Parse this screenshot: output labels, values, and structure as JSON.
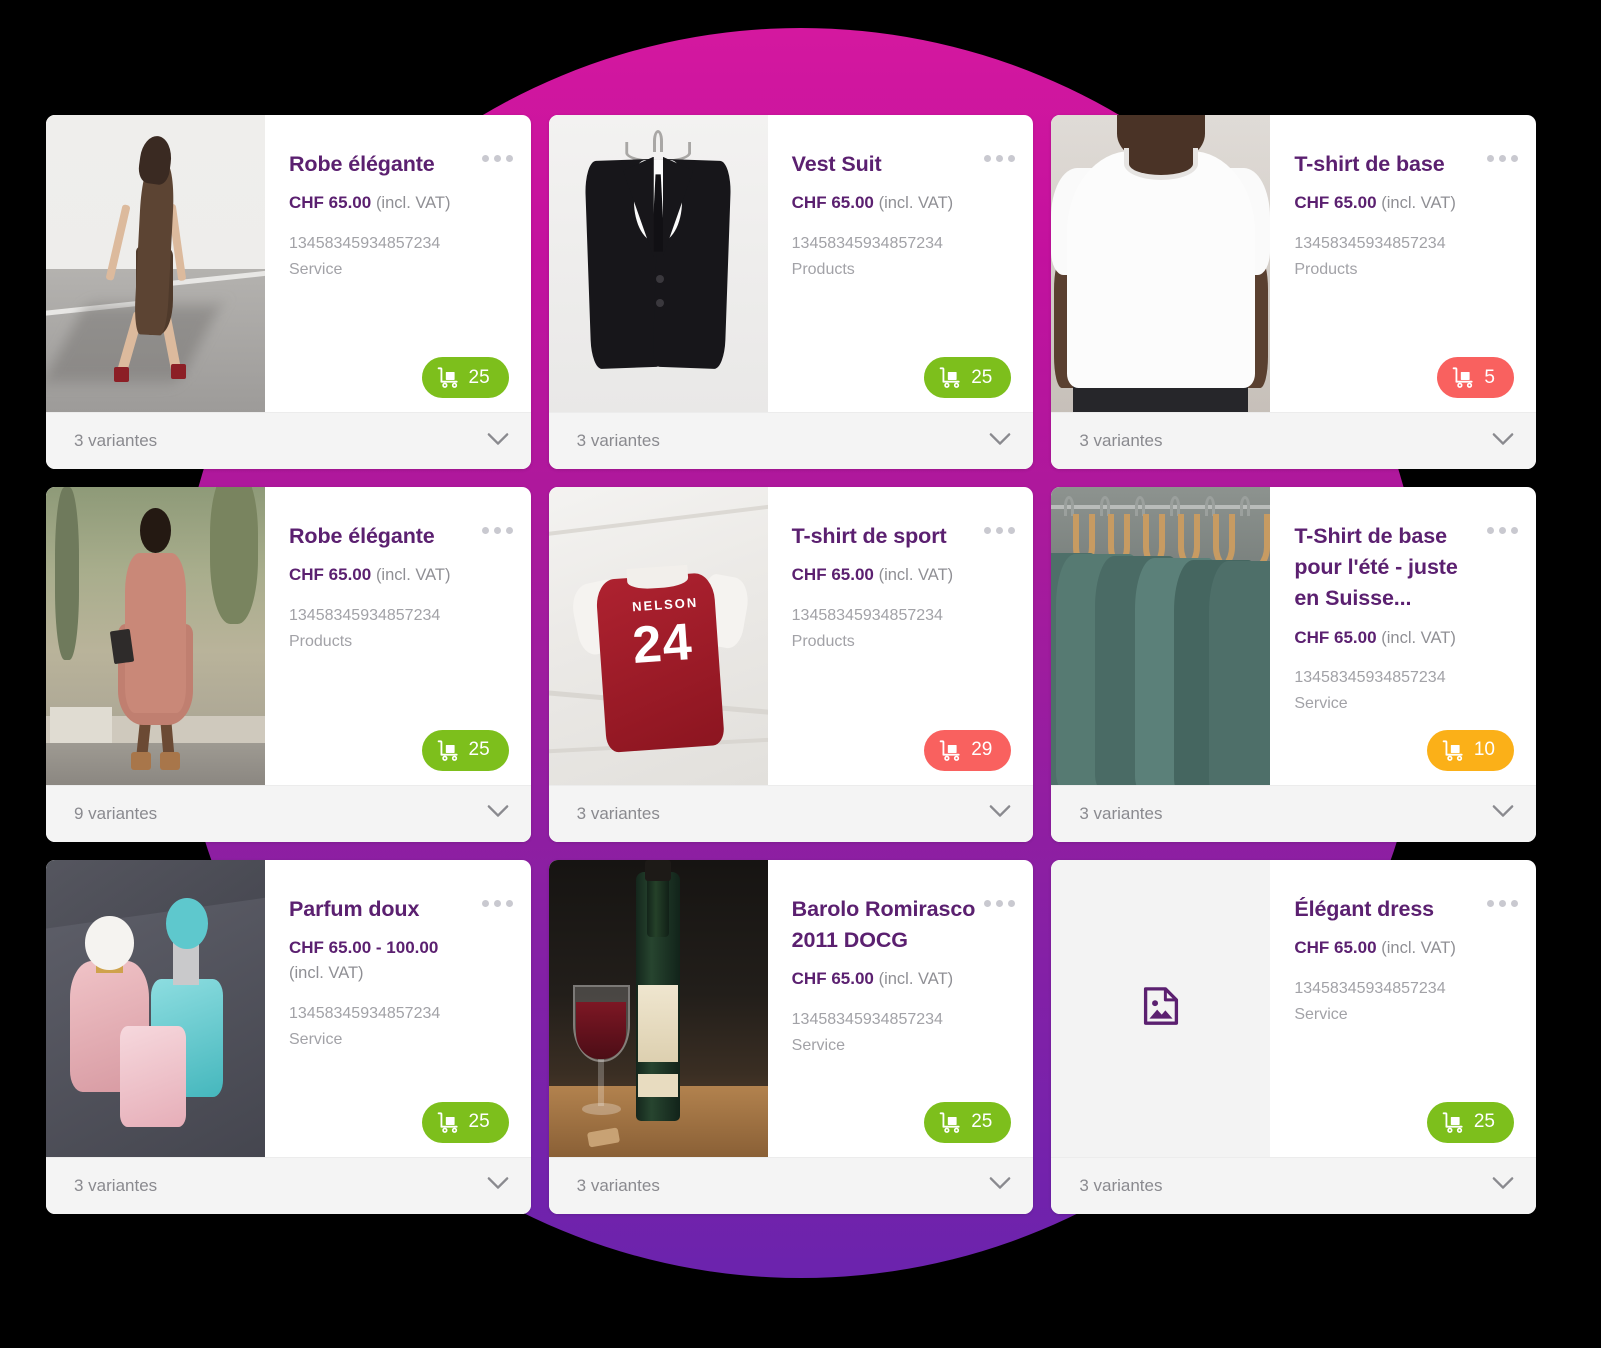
{
  "theme": {
    "accent_purple": "#5b2070",
    "gradient_top": "#d4189f",
    "gradient_bottom": "#6b23ad",
    "badge_green": "#7dbf1c",
    "badge_red": "#f9615f",
    "badge_orange": "#fbb018",
    "card_background": "#ffffff",
    "footer_background": "#f4f4f4",
    "muted_text": "#a2a2a7"
  },
  "labels": {
    "vat_suffix": "(incl. VAT)",
    "overflow_menu": "more-options",
    "expand": "expand-variants"
  },
  "products": [
    {
      "id": "robe-elegante-1",
      "title": "Robe élégante",
      "price": "CHF 65.00",
      "vat": "(incl. VAT)",
      "sku": "13458345934857234",
      "category": "Service",
      "stock": "25",
      "stock_color": "#7dbf1c",
      "variants": "3 variantes",
      "image": "img-dress1",
      "has_image": true
    },
    {
      "id": "vest-suit",
      "title": "Vest Suit",
      "price": "CHF 65.00",
      "vat": "(incl. VAT)",
      "sku": "13458345934857234",
      "category": "Products",
      "stock": "25",
      "stock_color": "#7dbf1c",
      "variants": "3 variantes",
      "image": "img-suit",
      "has_image": true
    },
    {
      "id": "t-shirt-de-base",
      "title": "T-shirt de base",
      "price": "CHF 65.00",
      "vat": "(incl. VAT)",
      "sku": "13458345934857234",
      "category": "Products",
      "stock": "5",
      "stock_color": "#f9615f",
      "variants": "3 variantes",
      "image": "img-tshirt-white",
      "has_image": true
    },
    {
      "id": "robe-elegante-2",
      "title": "Robe élégante",
      "price": "CHF 65.00",
      "vat": "(incl. VAT)",
      "sku": "13458345934857234",
      "category": "Products",
      "stock": "25",
      "stock_color": "#7dbf1c",
      "variants": "9 variantes",
      "image": "img-dress2",
      "has_image": true
    },
    {
      "id": "t-shirt-de-sport",
      "title": "T-shirt de sport",
      "price": "CHF 65.00",
      "vat": "(incl. VAT)",
      "sku": "13458345934857234",
      "category": "Products",
      "stock": "29",
      "stock_color": "#f9615f",
      "variants": "3 variantes",
      "image": "img-jersey",
      "has_image": true
    },
    {
      "id": "t-shirt-de-base-ete",
      "title": "T-Shirt de base pour l'été - juste en Suisse...",
      "price": "CHF 65.00",
      "vat": "(incl. VAT)",
      "sku": "13458345934857234",
      "category": "Service",
      "stock": "10",
      "stock_color": "#fbb018",
      "variants": "3 variantes",
      "image": "img-hangers",
      "has_image": true
    },
    {
      "id": "parfum-doux",
      "title": "Parfum doux",
      "price": "CHF 65.00 - 100.00",
      "vat": "(incl. VAT)",
      "vat_on_new_line": true,
      "sku": "13458345934857234",
      "category": "Service",
      "stock": "25",
      "stock_color": "#7dbf1c",
      "variants": "3 variantes",
      "image": "img-perfume",
      "has_image": true
    },
    {
      "id": "barolo-romirasco-2011-docg",
      "title": "Barolo Romirasco 2011 DOCG",
      "price": "CHF 65.00",
      "vat": "(incl. VAT)",
      "sku": "13458345934857234",
      "category": "Service",
      "stock": "25",
      "stock_color": "#7dbf1c",
      "variants": "3 variantes",
      "image": "img-wine",
      "has_image": true
    },
    {
      "id": "elegant-dress",
      "title": "Élégant dress",
      "price": "CHF 65.00",
      "vat": "(incl. VAT)",
      "sku": "13458345934857234",
      "category": "Service",
      "stock": "25",
      "stock_color": "#7dbf1c",
      "variants": "3 variantes",
      "image": "",
      "has_image": false
    }
  ]
}
